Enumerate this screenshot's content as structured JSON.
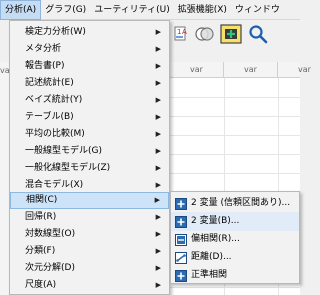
{
  "menubar": {
    "items": [
      {
        "label": "分析(A)"
      },
      {
        "label": "グラフ(G)"
      },
      {
        "label": "ユーティリティ(U)"
      },
      {
        "label": "拡張機能(X)"
      },
      {
        "label": "ウィンドウ"
      }
    ]
  },
  "grid": {
    "col_headers": [
      "var",
      "var",
      "var",
      "var"
    ],
    "left_header": "va"
  },
  "analyze_menu": {
    "items": [
      {
        "label": "検定力分析(W)",
        "submenu": true
      },
      {
        "label": "メタ分析",
        "submenu": true
      },
      {
        "label": "報告書(P)",
        "submenu": true
      },
      {
        "label": "記述統計(E)",
        "submenu": true
      },
      {
        "label": "ベイズ統計(Y)",
        "submenu": true
      },
      {
        "label": "テーブル(B)",
        "submenu": true
      },
      {
        "label": "平均の比較(M)",
        "submenu": true
      },
      {
        "label": "一般線型モデル(G)",
        "submenu": true
      },
      {
        "label": "一般化線型モデル(Z)",
        "submenu": true
      },
      {
        "label": "混合モデル(X)",
        "submenu": true
      },
      {
        "label": "相関(C)",
        "submenu": true,
        "active": true
      },
      {
        "label": "回帰(R)",
        "submenu": true
      },
      {
        "label": "対数線型(O)",
        "submenu": true
      },
      {
        "label": "分類(F)",
        "submenu": true
      },
      {
        "label": "次元分解(D)",
        "submenu": true
      },
      {
        "label": "尺度(A)",
        "submenu": true
      }
    ]
  },
  "correlate_submenu": {
    "items": [
      {
        "label": "2 変量 (信頼区間あり)...",
        "icon": "bivariate-ci-icon"
      },
      {
        "label": "2 変量(B)...",
        "icon": "bivariate-icon",
        "hover": true
      },
      {
        "label": "偏相関(R)...",
        "icon": "partial-correlation-icon"
      },
      {
        "label": "距離(D)...",
        "icon": "distance-icon"
      },
      {
        "label": "正準相関",
        "icon": "canonical-correlation-icon"
      }
    ]
  },
  "colors": {
    "menu_active": "#cde3f7",
    "menubar_active": "#c5dcf2",
    "icon_blue": "#2b6cb0"
  }
}
